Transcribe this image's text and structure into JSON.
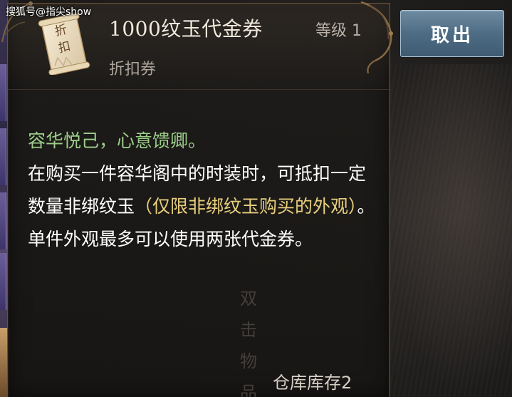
{
  "watermark": "搜狐号@指尖show",
  "item": {
    "icon_text": "折扣",
    "name": "1000纹玉代金券",
    "level": "等级 1",
    "type": "折扣券"
  },
  "description": {
    "flavor": "容华悦己，心意馈卿。",
    "text_part1": "在购买一件容华阁中的时装时，可抵扣一定数量非绑纹玉",
    "highlight": "（仅限非绑纹玉购买的外观）",
    "text_part2": "。单件外观最多可以使用两张代金券。"
  },
  "background_vertical_text": "双击物品",
  "storage": "仓库库存2",
  "buttons": {
    "withdraw": "取出"
  },
  "colors": {
    "flavor": "#9ccf8a",
    "highlight": "#e8cf7c",
    "button": "#4e6c84",
    "border": "#6a5238"
  },
  "icons": [
    "scroll-icon",
    "ornament-icon"
  ]
}
